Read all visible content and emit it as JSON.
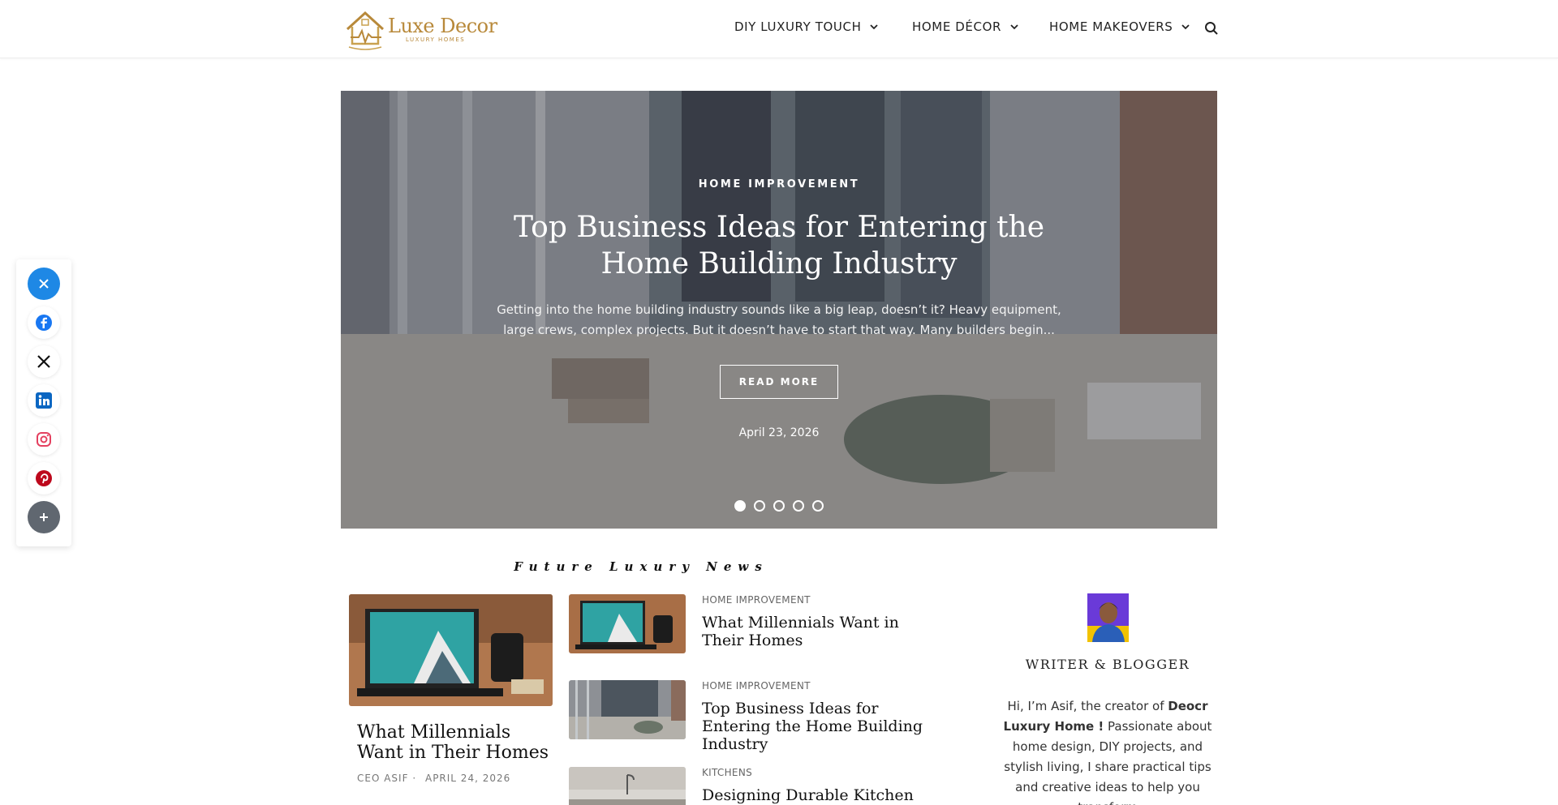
{
  "brand": {
    "name": "Luxe Decor",
    "tagline": "LUXURY HOMES",
    "color": "#b8893a"
  },
  "nav": {
    "items": [
      {
        "label": "DIY LUXURY TOUCH"
      },
      {
        "label": "HOME DÉCOR"
      },
      {
        "label": "HOME MAKEOVERS"
      }
    ],
    "search_icon": "search-icon"
  },
  "hero": {
    "category": "HOME IMPROVEMENT",
    "title": "Top Business Ideas for Entering the Home Building Industry",
    "excerpt": "Getting into the home building industry sounds like a big leap, doesn’t it? Heavy equipment, large crews, complex projects. But it doesn’t have to start that way. Many builders begin...",
    "button": "READ MORE",
    "date": "April 23, 2026",
    "slides": 5,
    "active_slide": 1
  },
  "social": {
    "icons": [
      "close-icon",
      "facebook-icon",
      "x-icon",
      "linkedin-icon",
      "instagram-icon",
      "pinterest-icon",
      "plus-icon"
    ],
    "colors": {
      "close": "#1e88e5",
      "facebook": "#1877f2",
      "linkedin": "#0a66c2",
      "instagram": "#e4405f",
      "pinterest": "#bd081c"
    }
  },
  "news": {
    "title": "Future Luxury News",
    "featured": {
      "title": "What Millennials Want in Their Homes",
      "author": "CEO ASIF",
      "separator": "·",
      "date": "APRIL 24, 2026"
    },
    "list": [
      {
        "category": "HOME IMPROVEMENT",
        "title": "What Millennials Want in Their Homes"
      },
      {
        "category": "HOME IMPROVEMENT",
        "title": "Top Business Ideas for Entering the Home Building Industry"
      },
      {
        "category": "KITCHENS",
        "title": "Designing Durable Kitchen"
      }
    ]
  },
  "sidebar": {
    "widget_title": "WRITER & BLOGGER",
    "intro_prefix": "Hi, I’m Asif, the creator of ",
    "intro_bold": "Deocr Luxury Home !",
    "intro_rest": " Passionate about home design, DIY projects, and stylish living, I share practical tips and creative ideas to help you transform"
  }
}
